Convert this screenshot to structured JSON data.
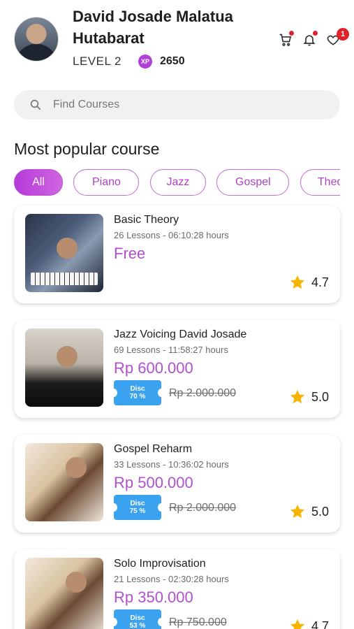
{
  "user": {
    "name": "David Josade Malatua Hutabarat",
    "level": "LEVEL 2",
    "xp_label": "XP",
    "xp_value": "2650"
  },
  "header_icons": {
    "cart": "cart-icon",
    "bell": "bell-icon",
    "heart": "heart-icon",
    "heart_badge": "1"
  },
  "search": {
    "placeholder": "Find Courses",
    "value": ""
  },
  "section": {
    "title": "Most popular course"
  },
  "filters": [
    "All",
    "Piano",
    "Jazz",
    "Gospel",
    "Theory"
  ],
  "courses": [
    {
      "title": "Basic Theory",
      "meta": "26 Lessons - 06:10:28 hours",
      "price": "Free",
      "disc_label": "",
      "disc_pct": "",
      "old_price": "",
      "rating": "4.7"
    },
    {
      "title": "Jazz Voicing David Josade",
      "meta": "69 Lessons - 11:58:27 hours",
      "price": "Rp 600.000",
      "disc_label": "Disc",
      "disc_pct": "70 %",
      "old_price": "Rp 2.000.000",
      "rating": "5.0"
    },
    {
      "title": "Gospel Reharm",
      "meta": "33 Lessons - 10:36:02 hours",
      "price": "Rp 500.000",
      "disc_label": "Disc",
      "disc_pct": "75 %",
      "old_price": "Rp 2.000.000",
      "rating": "5.0"
    },
    {
      "title": "Solo Improvisation",
      "meta": "21 Lessons - 02:30:28 hours",
      "price": "Rp 350.000",
      "disc_label": "Disc",
      "disc_pct": "53 %",
      "old_price": "Rp 750.000",
      "rating": "4.7"
    }
  ],
  "colors": {
    "accent": "#b24fcf",
    "discount": "#3aa2ee",
    "star": "#f7b500",
    "badge": "#e0202a"
  }
}
